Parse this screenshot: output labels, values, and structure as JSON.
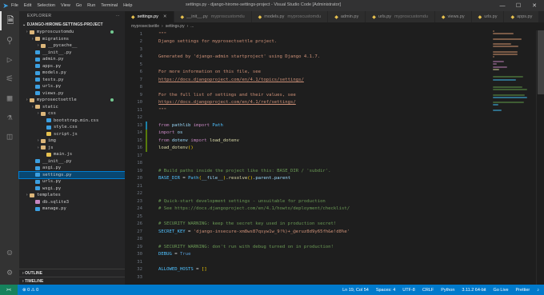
{
  "titlebar": {
    "menu": [
      "File",
      "Edit",
      "Selection",
      "View",
      "Go",
      "Run",
      "Terminal",
      "Help"
    ],
    "window_title": "settings.py - django-hirome-settings-project - Visual Studio Code [Administrator]"
  },
  "activity_bar": {
    "icons": [
      "files-icon",
      "search-icon",
      "run-debug-icon",
      "source-control-icon",
      "extensions-icon",
      "testing-icon",
      "docker-icon"
    ]
  },
  "sidebar": {
    "header": "EXPLORER",
    "workspace": "DJANGO-HIROME-SETTINGS-PROJECT",
    "tree": [
      {
        "label": "myproscustomdu",
        "depth": 0,
        "kind": "folder",
        "color": "#dcb67a",
        "badge": true
      },
      {
        "label": "migrations",
        "depth": 1,
        "kind": "folder",
        "color": "#dcb67a"
      },
      {
        "label": "__pycache__",
        "depth": 2,
        "kind": "folder",
        "color": "#dcb67a"
      },
      {
        "label": "__init__.py",
        "depth": 1,
        "kind": "py",
        "color": "#3c9fe0"
      },
      {
        "label": "admin.py",
        "depth": 1,
        "kind": "py",
        "color": "#3c9fe0"
      },
      {
        "label": "apps.py",
        "depth": 1,
        "kind": "py",
        "color": "#3c9fe0"
      },
      {
        "label": "models.py",
        "depth": 1,
        "kind": "py",
        "color": "#3c9fe0"
      },
      {
        "label": "tests.py",
        "depth": 1,
        "kind": "py",
        "color": "#3c9fe0"
      },
      {
        "label": "urls.py",
        "depth": 1,
        "kind": "py",
        "color": "#3c9fe0"
      },
      {
        "label": "views.py",
        "depth": 1,
        "kind": "py",
        "color": "#3c9fe0"
      },
      {
        "label": "myprosectsettle",
        "depth": 0,
        "kind": "folder",
        "color": "#dcb67a",
        "badge": true
      },
      {
        "label": "static",
        "depth": 1,
        "kind": "folder",
        "color": "#dcb67a"
      },
      {
        "label": "css",
        "depth": 2,
        "kind": "folder",
        "color": "#dcb67a"
      },
      {
        "label": "bootstrap.min.css",
        "depth": 3,
        "kind": "css",
        "color": "#3c9fe0"
      },
      {
        "label": "style.css",
        "depth": 3,
        "kind": "css",
        "color": "#3c9fe0"
      },
      {
        "label": "script.js",
        "depth": 3,
        "kind": "js",
        "color": "#e8c24f"
      },
      {
        "label": "img",
        "depth": 2,
        "kind": "folder",
        "color": "#dcb67a"
      },
      {
        "label": "js",
        "depth": 2,
        "kind": "folder",
        "color": "#dcb67a"
      },
      {
        "label": "main.js",
        "depth": 3,
        "kind": "js",
        "color": "#e8c24f"
      },
      {
        "label": "__init__.py",
        "depth": 1,
        "kind": "py",
        "color": "#3c9fe0"
      },
      {
        "label": "asgi.py",
        "depth": 1,
        "kind": "py",
        "color": "#3c9fe0"
      },
      {
        "label": "settings.py",
        "depth": 1,
        "kind": "py",
        "color": "#3c9fe0",
        "selected": true
      },
      {
        "label": "urls.py",
        "depth": 1,
        "kind": "py",
        "color": "#3c9fe0"
      },
      {
        "label": "wsgi.py",
        "depth": 1,
        "kind": "py",
        "color": "#3c9fe0"
      },
      {
        "label": "templates",
        "depth": 0,
        "kind": "folder",
        "color": "#dcb67a"
      },
      {
        "label": "db.sqlite3",
        "depth": 1,
        "kind": "db",
        "color": "#c586c0"
      },
      {
        "label": "manage.py",
        "depth": 1,
        "kind": "py",
        "color": "#3c9fe0"
      }
    ],
    "bottom_sections": [
      "OUTLINE",
      "TIMELINE"
    ]
  },
  "tabs": [
    {
      "icon": "python-file-icon",
      "label": "settings.py",
      "active": true
    },
    {
      "icon": "python-file-icon",
      "label": "__init__.py",
      "desc": "myproscustomdu"
    },
    {
      "icon": "python-file-icon",
      "label": "models.py",
      "desc": "myproscustomdu"
    },
    {
      "icon": "python-file-icon",
      "label": "admin.py"
    },
    {
      "icon": "python-file-icon",
      "label": "urls.py",
      "desc": "myproscustomdu"
    },
    {
      "icon": "python-file-icon",
      "label": "views.py"
    },
    {
      "icon": "python-file-icon",
      "label": "urls.py"
    },
    {
      "icon": "python-file-icon",
      "label": "apps.py"
    }
  ],
  "breadcrumb": [
    "myprosectsettle",
    "settings.py",
    "..."
  ],
  "code_lines": [
    [
      {
        "t": "\"\"\"",
        "c": "str"
      }
    ],
    [
      {
        "t": "Django settings for myprosectsettle project.",
        "c": "str"
      }
    ],
    [],
    [
      {
        "t": "Generated by 'django-admin startproject' using Django 4.1.7.",
        "c": "str"
      }
    ],
    [],
    [
      {
        "t": "For more information on this file, see",
        "c": "str"
      }
    ],
    [
      {
        "t": "https://docs.djangoproject.com/en/4.1/topics/settings/",
        "c": "url"
      }
    ],
    [],
    [
      {
        "t": "For the full list of settings and their values, see",
        "c": "str"
      }
    ],
    [
      {
        "t": "https://docs.djangoproject.com/en/4.1/ref/settings/",
        "c": "url"
      }
    ],
    [
      {
        "t": "\"\"\"",
        "c": "str"
      }
    ],
    [],
    [
      {
        "t": "from ",
        "c": "kw"
      },
      {
        "t": "pathlib ",
        "c": "var"
      },
      {
        "t": "import ",
        "c": "kw"
      },
      {
        "t": "Path",
        "c": "con"
      }
    ],
    [
      {
        "t": "import ",
        "c": "kw"
      },
      {
        "t": "os",
        "c": "var"
      }
    ],
    [
      {
        "t": "from ",
        "c": "kw"
      },
      {
        "t": "dotenv ",
        "c": "var"
      },
      {
        "t": "import ",
        "c": "kw"
      },
      {
        "t": "load_dotenv",
        "c": "fn"
      }
    ],
    [
      {
        "t": "load_dotenv",
        "c": "fn"
      },
      {
        "t": "()",
        "c": "br"
      }
    ],
    [],
    [],
    [
      {
        "t": "# Build paths inside the project like this: BASE_DIR / 'subdir'.",
        "c": "com"
      }
    ],
    [
      {
        "t": "BASE_DIR ",
        "c": "con"
      },
      {
        "t": "= ",
        "c": "op"
      },
      {
        "t": "Path",
        "c": "con"
      },
      {
        "t": "(",
        "c": "br"
      },
      {
        "t": "__file__",
        "c": "var"
      },
      {
        "t": ")",
        "c": "br"
      },
      {
        "t": ".",
        "c": "op"
      },
      {
        "t": "resolve",
        "c": "fn"
      },
      {
        "t": "()",
        "c": "br"
      },
      {
        "t": ".parent.parent",
        "c": "var"
      }
    ],
    [],
    [],
    [
      {
        "t": "# Quick-start development settings - unsuitable for production",
        "c": "com"
      }
    ],
    [
      {
        "t": "# See https://docs.djangoproject.com/en/4.1/howto/deployment/checklist/",
        "c": "com"
      }
    ],
    [],
    [
      {
        "t": "# SECURITY WARNING: keep the secret key used in production secret!",
        "c": "com"
      }
    ],
    [
      {
        "t": "SECRET_KEY ",
        "c": "con"
      },
      {
        "t": "= ",
        "c": "op"
      },
      {
        "t": "'django-insecure-xm8ws87qsyw1w_9!%)+_@eruz8d9y65fh&e!d8%e'",
        "c": "str"
      }
    ],
    [],
    [
      {
        "t": "# SECURITY WARNING: don't run with debug turned on in production!",
        "c": "com"
      }
    ],
    [
      {
        "t": "DEBUG ",
        "c": "con"
      },
      {
        "t": "= ",
        "c": "op"
      },
      {
        "t": "True",
        "c": "bool"
      }
    ],
    [],
    [
      {
        "t": "ALLOWED_HOSTS ",
        "c": "con"
      },
      {
        "t": "= ",
        "c": "op"
      },
      {
        "t": "[]",
        "c": "br"
      }
    ],
    []
  ],
  "line_numbers": [
    "1",
    "2",
    "3",
    "4",
    "5",
    "6",
    "7",
    "8",
    "9",
    "10",
    "11",
    "12",
    "13",
    "14",
    "15",
    "16",
    "17",
    "18",
    "19",
    "20",
    "21",
    "22",
    "23",
    "24",
    "25",
    "26",
    "27",
    "28",
    "29",
    "30",
    "31",
    "32",
    "33"
  ],
  "statusbar": {
    "remote": "><",
    "branch": "",
    "right": [
      "Ln 19, Col 54",
      "Spaces: 4",
      "UTF-8",
      "CRLF",
      "Python",
      "3.11.2 64-bit",
      "Go Live",
      "Prettier"
    ]
  },
  "colors": {
    "statusbar": "#007acc",
    "accent": "#007fd4"
  }
}
